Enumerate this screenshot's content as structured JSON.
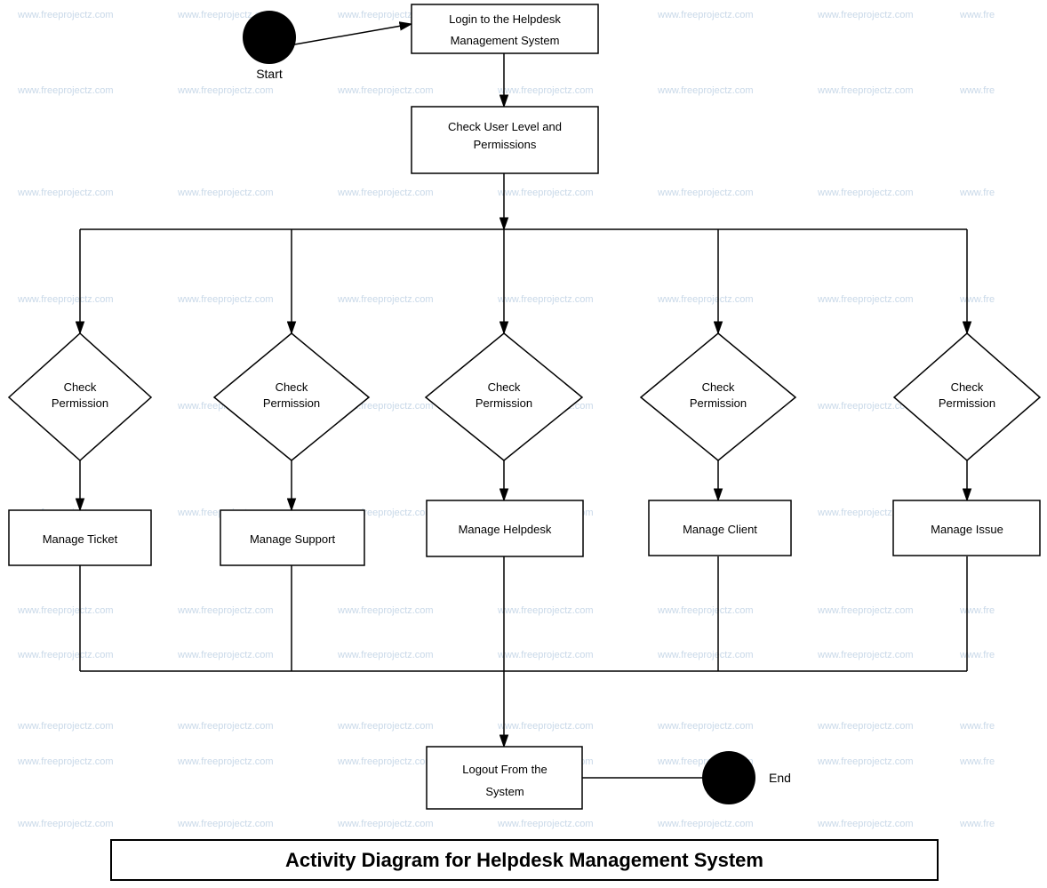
{
  "diagram": {
    "title": "Activity Diagram for Helpdesk Management System",
    "watermark": "www.freeprojectz.com",
    "nodes": {
      "start": {
        "label": "Start",
        "type": "circle"
      },
      "end": {
        "label": "End",
        "type": "circle"
      },
      "login": {
        "label": "Login to the Helpdesk Management System",
        "type": "rect"
      },
      "check_user": {
        "label": "Check User Level and Permissions",
        "type": "rect"
      },
      "check_perm1": {
        "label": "Check Permission",
        "type": "diamond"
      },
      "check_perm2": {
        "label": "Check Permission",
        "type": "diamond"
      },
      "check_perm3": {
        "label": "Check Permission",
        "type": "diamond"
      },
      "check_perm4": {
        "label": "Check Permission",
        "type": "diamond"
      },
      "check_perm5": {
        "label": "Check Permission",
        "type": "diamond"
      },
      "manage_ticket": {
        "label": "Manage Ticket",
        "type": "rect"
      },
      "manage_support": {
        "label": "Manage Support",
        "type": "rect"
      },
      "manage_helpdesk": {
        "label": "Manage Helpdesk",
        "type": "rect"
      },
      "manage_client": {
        "label": "Manage Client",
        "type": "rect"
      },
      "manage_issue": {
        "label": "Manage Issue",
        "type": "rect"
      },
      "logout": {
        "label": "Logout From the System",
        "type": "rect"
      }
    }
  }
}
